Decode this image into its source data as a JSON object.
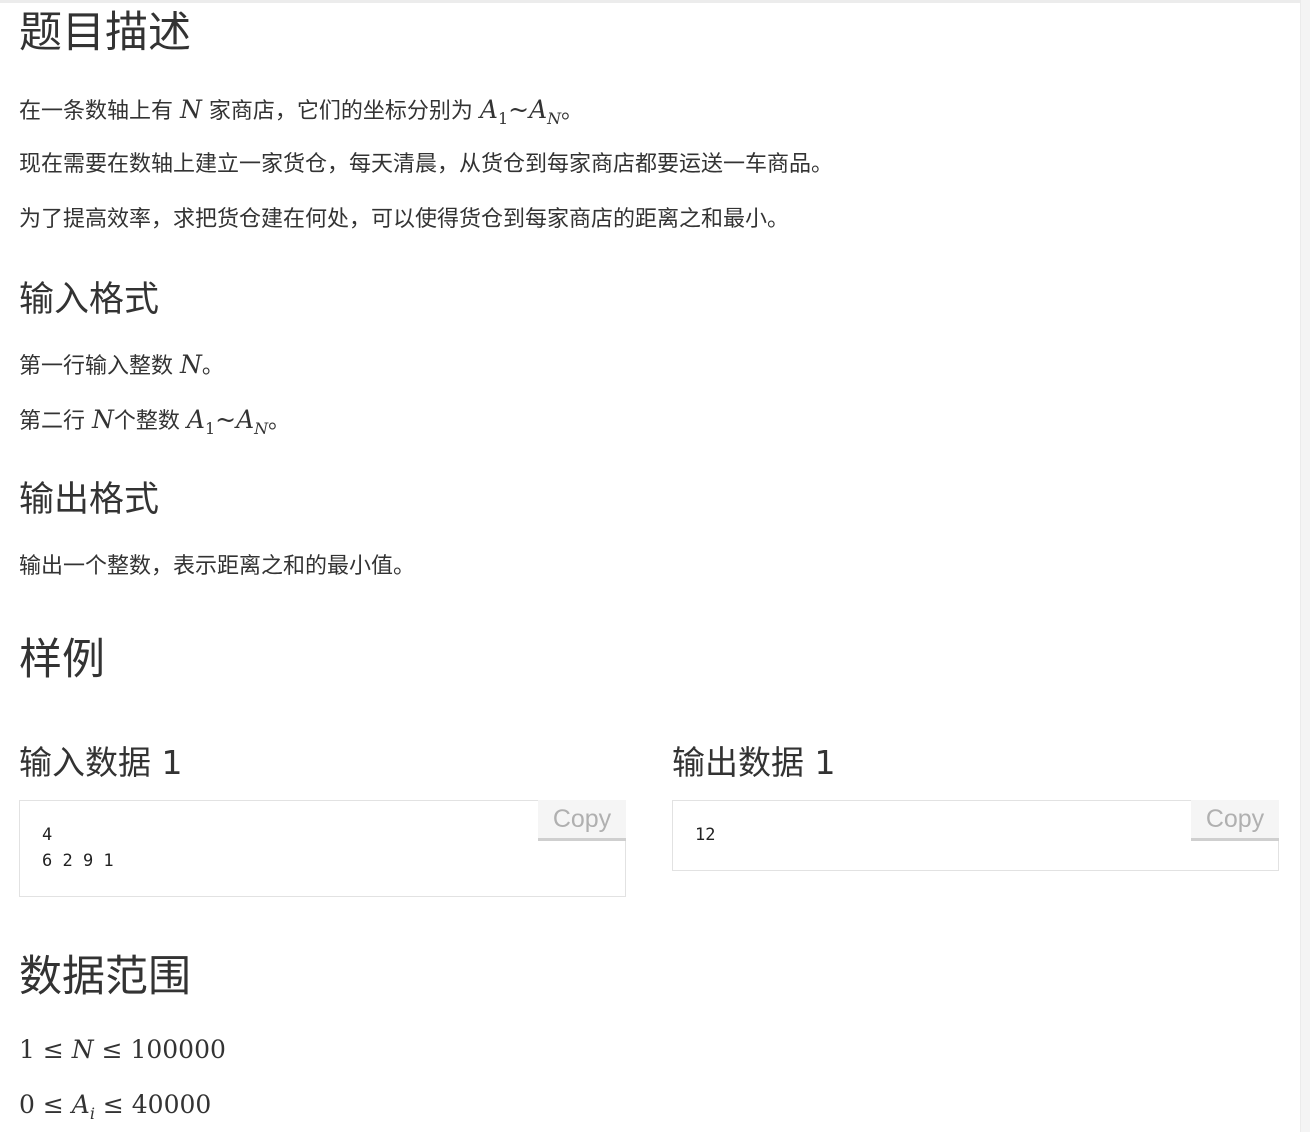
{
  "description": {
    "title": "题目描述",
    "line1": {
      "pre": "在一条数轴上有 ",
      "var": "N",
      "mid": " 家商店，它们的坐标分别为 ",
      "a": "A",
      "sub1": "1",
      "tilde": "~",
      "b": "A",
      "subN": "N",
      "post": "。"
    },
    "line2": "现在需要在数轴上建立一家货仓，每天清晨，从货仓到每家商店都要运送一车商品。",
    "line3": "为了提高效率，求把货仓建在何处，可以使得货仓到每家商店的距离之和最小。"
  },
  "input_format": {
    "title": "输入格式",
    "line1": {
      "pre": "第一行输入整数 ",
      "var": "N",
      "post": "。"
    },
    "line2": {
      "pre": "第二行 ",
      "var": "N",
      "mid": "个整数 ",
      "a": "A",
      "sub1": "1",
      "tilde": "~",
      "b": "A",
      "subN": "N",
      "post": "。"
    }
  },
  "output_format": {
    "title": "输出格式",
    "line1": "输出一个整数，表示距离之和的最小值。"
  },
  "samples": {
    "title": "样例",
    "input": {
      "title": "输入数据 1",
      "content": "4\n6 2 9 1",
      "copy_label": "Copy"
    },
    "output": {
      "title": "输出数据 1",
      "content": "12",
      "copy_label": "Copy"
    }
  },
  "range": {
    "title": "数据范围",
    "line1": {
      "low": "1",
      "op1": " ≤ ",
      "var": "N",
      "op2": " ≤ ",
      "high": "100000"
    },
    "line2": {
      "low": "0",
      "op1": " ≤ ",
      "var": "A",
      "sub": "i",
      "op2": " ≤ ",
      "high": "40000"
    }
  }
}
